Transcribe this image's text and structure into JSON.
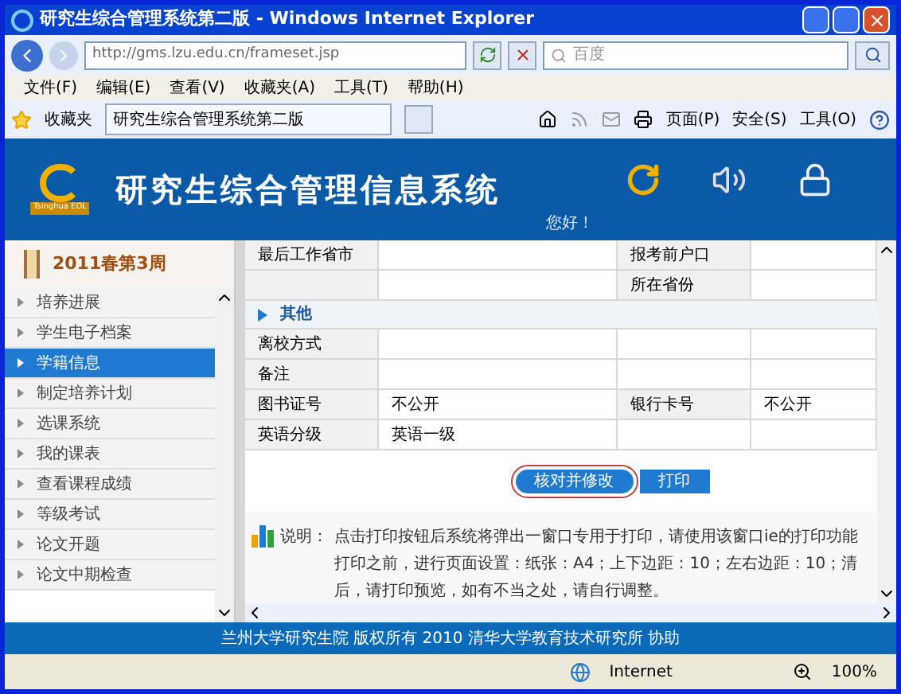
{
  "window": {
    "title": "研究生综合管理系统第二版 - Windows Internet Explorer"
  },
  "address_bar": {
    "url": "http://gms.lzu.edu.cn/frameset.jsp",
    "search_placeholder": "百度"
  },
  "menu": [
    "文件(F)",
    "编辑(E)",
    "查看(V)",
    "收藏夹(A)",
    "工具(T)",
    "帮助(H)"
  ],
  "favorites_bar": {
    "favorites": "收藏夹",
    "tab": "研究生综合管理系统第二版",
    "tools": [
      "页面(P)",
      "安全(S)",
      "工具(O)"
    ]
  },
  "banner": {
    "title": "研究生综合管理信息系统",
    "logo_text": "Tsinghua EOL",
    "greeting": "您好！"
  },
  "sidebar": {
    "week": "2011春第3周",
    "items": [
      {
        "label": "培养进展",
        "selected": false
      },
      {
        "label": "学生电子档案",
        "selected": false
      },
      {
        "label": "学籍信息",
        "selected": true
      },
      {
        "label": "制定培养计划",
        "selected": false
      },
      {
        "label": "选课系统",
        "selected": false
      },
      {
        "label": "我的课表",
        "selected": false
      },
      {
        "label": "查看课程成绩",
        "selected": false
      },
      {
        "label": "等级考试",
        "selected": false
      },
      {
        "label": "论文开题",
        "selected": false
      },
      {
        "label": "论文中期检查",
        "selected": false
      }
    ]
  },
  "form": {
    "top_rows": [
      {
        "label": "最后工作省市",
        "value": "",
        "label2": "报考前户口",
        "value2": ""
      },
      {
        "label": "",
        "value": "",
        "label2": "所在省份",
        "value2": ""
      }
    ],
    "section": "其他",
    "rows": [
      {
        "label": "离校方式",
        "value": "",
        "label2": "",
        "value2": ""
      },
      {
        "label": "备注",
        "value": "",
        "label2": "",
        "value2": ""
      },
      {
        "label": "图书证号",
        "value": "不公开",
        "label2": "银行卡号",
        "value2": "不公开"
      },
      {
        "label": "英语分级",
        "value": "英语一级",
        "label2": "",
        "value2": ""
      }
    ],
    "buttons": [
      {
        "label": "核对并修改",
        "circled": true
      },
      {
        "label": "打印",
        "circled": false
      }
    ]
  },
  "note": {
    "title": "说明：",
    "lines": [
      "点击打印按钮后系统将弹出一窗口专用于打印，请使用该窗口ie的打印功能",
      "打印之前，进行页面设置：纸张：A4；上下边距：10；左右边距：10；清",
      "后，请打印预览，如有不当之处，请自行调整。"
    ]
  },
  "footer": "兰州大学研究生院 版权所有 2010 清华大学教育技术研究所 协助",
  "status_bar": {
    "zone": "Internet",
    "zoom": "100%"
  }
}
